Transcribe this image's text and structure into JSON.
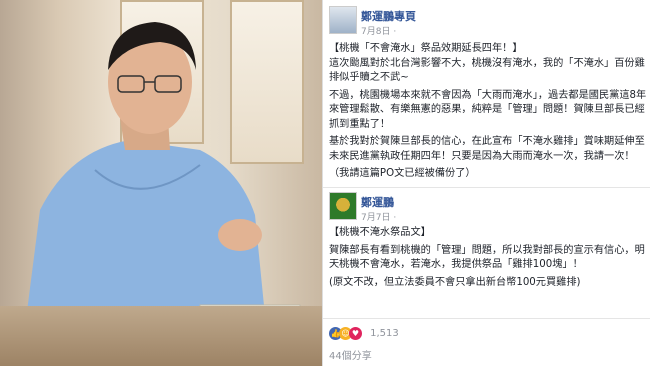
{
  "post1": {
    "author": "鄭運鵬專頁",
    "date": "7月8日 ·",
    "headline": "【桃機「不會淹水」祭品效期延長四年！】",
    "para1": "這次颱風對於北台灣影響不大，桃機沒有淹水，我的「不淹水」百份雞排似乎贖之不武~",
    "para2": "不過，桃園機場本來就不會因為「大雨而淹水」，過去都是國民黨這8年來管理鬆散、有樂無憲的惡果，純粹是「管理」問題！賀陳旦部長已經抓到重點了！",
    "para3": "基於我對於賀陳旦部長的信心，在此宣布「不淹水雞排」賞味期延伸至未來民進黨執政任期四年！只要是因為大雨而淹水一次，我請一次！",
    "para4": "（我請這篇PO文已經被備份了）"
  },
  "post2": {
    "author": "鄭運鵬",
    "date": "7月7日 ·",
    "headline": "【桃機不淹水祭品文】",
    "para1": "賀陳部長有看到桃機的「管理」問題，所以我對部長的宣示有信心，明天桃機不會淹水，若淹水，我提供祭品「雞排100塊」！",
    "para2": "(原文不改，但立法委員不會只拿出新台幣100元買雞排)"
  },
  "reactions": {
    "count": "1,513",
    "icons": [
      "like-icon",
      "haha-icon",
      "love-icon"
    ],
    "colors": {
      "like": "#4267b2",
      "haha": "#f7b125",
      "love": "#e0245e"
    }
  },
  "views": "44個分享"
}
